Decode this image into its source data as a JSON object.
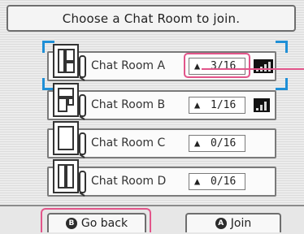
{
  "header": {
    "title": "Choose a Chat Room to join."
  },
  "rooms": [
    {
      "name": "Chat Room A",
      "count": "3/16",
      "signal": "strong"
    },
    {
      "name": "Chat Room B",
      "count": "1/16",
      "signal": "medium"
    },
    {
      "name": "Chat Room C",
      "count": "0/16",
      "signal": "none"
    },
    {
      "name": "Chat Room D",
      "count": "0/16",
      "signal": "none"
    }
  ],
  "footer": {
    "back": {
      "icon_letter": "B",
      "label": "Go back"
    },
    "join": {
      "icon_letter": "A",
      "label": "Join"
    }
  },
  "colors": {
    "highlight": "#e2558a",
    "selection": "#1f8fd6"
  },
  "icons": {
    "room_icon": "chat-room-icon",
    "person_icon": "person-icon",
    "signal_icon": "signal-strength-icon"
  }
}
